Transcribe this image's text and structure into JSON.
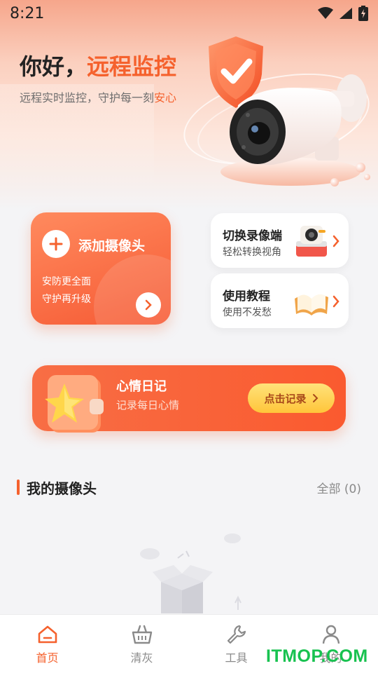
{
  "status_bar": {
    "time": "8:21",
    "icons": [
      "wifi-icon",
      "signal-icon",
      "battery-charging-icon"
    ]
  },
  "greeting": {
    "prefix": "你好，",
    "accent": "远程监控",
    "subtitle_prefix": "远程实时监控，守护每一刻",
    "subtitle_accent": "安心"
  },
  "add_camera_card": {
    "label": "添加摄像头",
    "line1": "安防更全面",
    "line2": "守护再升级",
    "icons": [
      "plus-icon",
      "chevron-right-icon"
    ]
  },
  "switch_recorder_card": {
    "title": "切换录像端",
    "subtitle": "轻松转换视角",
    "icon": "camera-device-icon"
  },
  "tutorial_card": {
    "title": "使用教程",
    "subtitle": "使用不发愁",
    "icon": "open-book-icon"
  },
  "diary_banner": {
    "title": "心情日记",
    "subtitle": "记录每日心情",
    "button_label": "点击记录",
    "icon": "star-book-icon"
  },
  "my_cameras": {
    "title": "我的摄像头",
    "all_label": "全部 (0)"
  },
  "tab_bar": {
    "tabs": [
      {
        "label": "首页",
        "icon": "home-icon",
        "active": true
      },
      {
        "label": "清灰",
        "icon": "basket-icon",
        "active": false
      },
      {
        "label": "工具",
        "icon": "wrench-icon",
        "active": false
      },
      {
        "label": "我的",
        "icon": "user-icon",
        "active": false
      }
    ]
  },
  "watermark": "ITMOP.COM",
  "colors": {
    "accent": "#f5612d",
    "button_yellow": "#ffc53a",
    "watermark": "#18c250"
  }
}
